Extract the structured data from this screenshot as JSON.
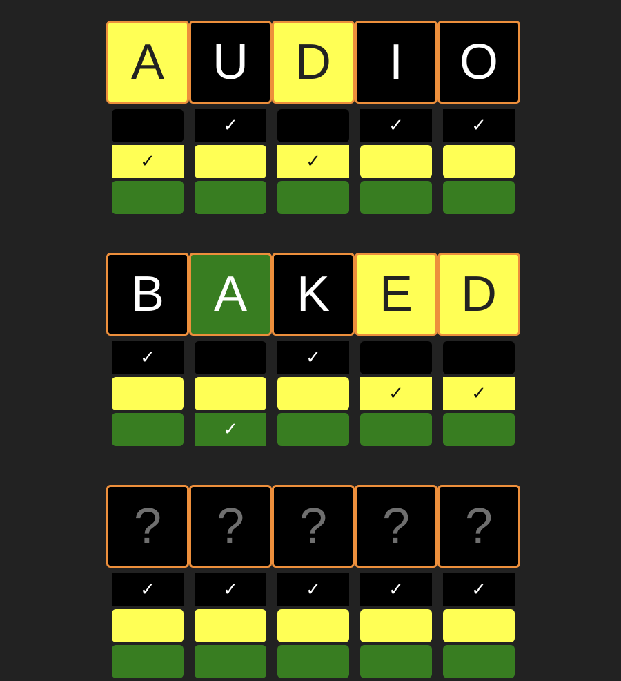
{
  "colors": {
    "background": "#222222",
    "tile_border": "#ed8f3c",
    "black": "#000000",
    "yellow": "#ffff55",
    "green": "#387d21",
    "unknown_text": "#6f6f6f"
  },
  "check_glyph": "✓",
  "icons": {
    "check": "checkmark-icon"
  },
  "guesses": [
    {
      "tiles": [
        {
          "letter": "A",
          "color": "yellow"
        },
        {
          "letter": "U",
          "color": "black"
        },
        {
          "letter": "D",
          "color": "yellow"
        },
        {
          "letter": "I",
          "color": "black"
        },
        {
          "letter": "O",
          "color": "black"
        }
      ],
      "selected": [
        "yellow",
        "black",
        "yellow",
        "black",
        "black"
      ]
    },
    {
      "tiles": [
        {
          "letter": "B",
          "color": "black"
        },
        {
          "letter": "A",
          "color": "green"
        },
        {
          "letter": "K",
          "color": "black"
        },
        {
          "letter": "E",
          "color": "yellow"
        },
        {
          "letter": "D",
          "color": "yellow"
        }
      ],
      "selected": [
        "black",
        "green",
        "black",
        "yellow",
        "yellow"
      ]
    },
    {
      "tiles": [
        {
          "letter": "?",
          "color": "unknown"
        },
        {
          "letter": "?",
          "color": "unknown"
        },
        {
          "letter": "?",
          "color": "unknown"
        },
        {
          "letter": "?",
          "color": "unknown"
        },
        {
          "letter": "?",
          "color": "unknown"
        }
      ],
      "selected": [
        "black",
        "black",
        "black",
        "black",
        "black"
      ]
    }
  ],
  "option_colors": [
    "black",
    "yellow",
    "green"
  ]
}
